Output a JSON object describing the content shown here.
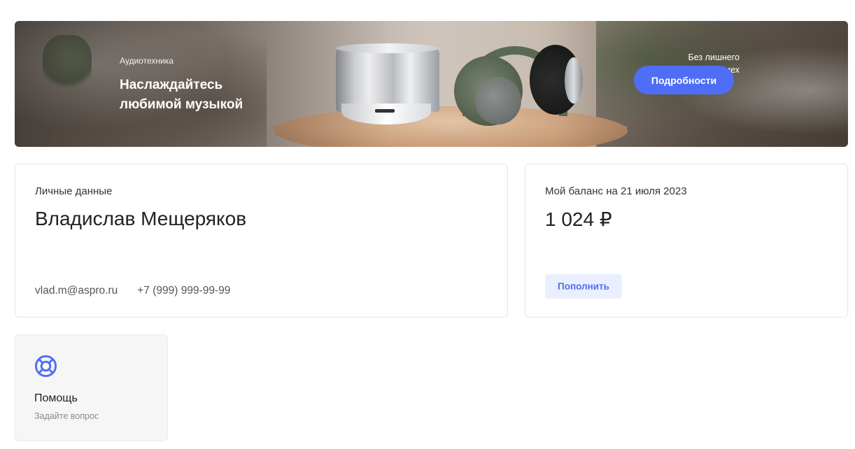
{
  "banner": {
    "eyebrow": "Аудиотехника",
    "title": "Наслаждайтесь любимой музыкой",
    "side_text": "Без лишнего шума и помех",
    "button_label": "Подробности",
    "accent_color": "#4f6ef7"
  },
  "personal": {
    "label": "Личные данные",
    "name": "Владислав Мещеряков",
    "email": "vlad.m@aspro.ru",
    "phone": "+7 (999) 999-99-99"
  },
  "balance": {
    "label": "Мой баланс на 21 июля 2023",
    "amount": "1 024 ₽",
    "button_label": "Пополнить"
  },
  "help": {
    "icon": "lifebuoy-icon",
    "title": "Помощь",
    "subtitle": "Задайте вопрос"
  }
}
